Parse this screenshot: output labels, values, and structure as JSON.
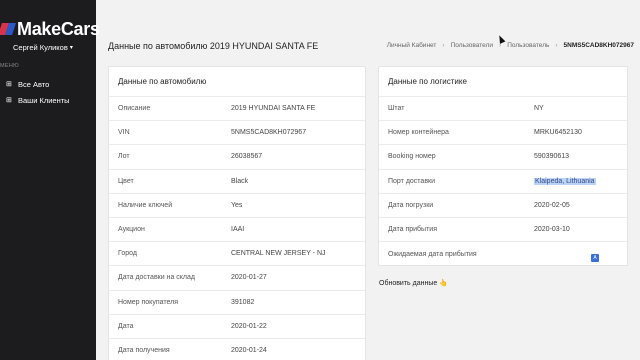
{
  "brand": {
    "name": "MakeCars",
    "colors": {
      "red": "#d8334a",
      "blue": "#2b58c9"
    }
  },
  "sidebar": {
    "user_name": "Сергей Куликов",
    "menu_label": "МЕНЮ",
    "items": [
      {
        "label": "Все Авто",
        "icon": "car-icon"
      },
      {
        "label": "Ваши Клиенты",
        "icon": "users-icon"
      }
    ]
  },
  "header": {
    "title": "Данные по автомобилю 2019 HYUNDAI SANTA FE",
    "breadcrumb": [
      "Личный Кабинет",
      "Пользователи",
      "Пользователь",
      "5NMS5CAD8KH072967"
    ]
  },
  "vehicle": {
    "title": "Данные по автомобилю",
    "rows": [
      {
        "label": "Описание",
        "value": "2019 HYUNDAI SANTA FE"
      },
      {
        "label": "VIN",
        "value": "5NMS5CAD8KH072967"
      },
      {
        "label": "Лот",
        "value": "26038567"
      },
      {
        "label": "Цвет",
        "value": "Black"
      },
      {
        "label": "Наличие ключей",
        "value": "Yes"
      },
      {
        "label": "Аукцион",
        "value": "IAAI"
      },
      {
        "label": "Город",
        "value": "CENTRAL NEW JERSEY - NJ"
      },
      {
        "label": "Дата доставки на склад",
        "value": "2020-01-27"
      },
      {
        "label": "Номер покупателя",
        "value": "391082"
      },
      {
        "label": "Дата",
        "value": "2020-01-22"
      },
      {
        "label": "Дата получения",
        "value": "2020-01-24"
      }
    ]
  },
  "logistics": {
    "title": "Данные по логистике",
    "rows": [
      {
        "label": "Штат",
        "value": "NY"
      },
      {
        "label": "Номер контейнера",
        "value": "MRKU6452130"
      },
      {
        "label": "Booking номер",
        "value": "590390613"
      },
      {
        "label": "Порт доставки",
        "value": "Klaipeda, Lithuania"
      },
      {
        "label": "Дата погрузки",
        "value": "2020-02-05"
      },
      {
        "label": "Дата прибытия",
        "value": "2020-03-10"
      },
      {
        "label": "Ожидаемая дата прибытия",
        "value": ""
      }
    ]
  },
  "refresh_label": "Обновить данные"
}
